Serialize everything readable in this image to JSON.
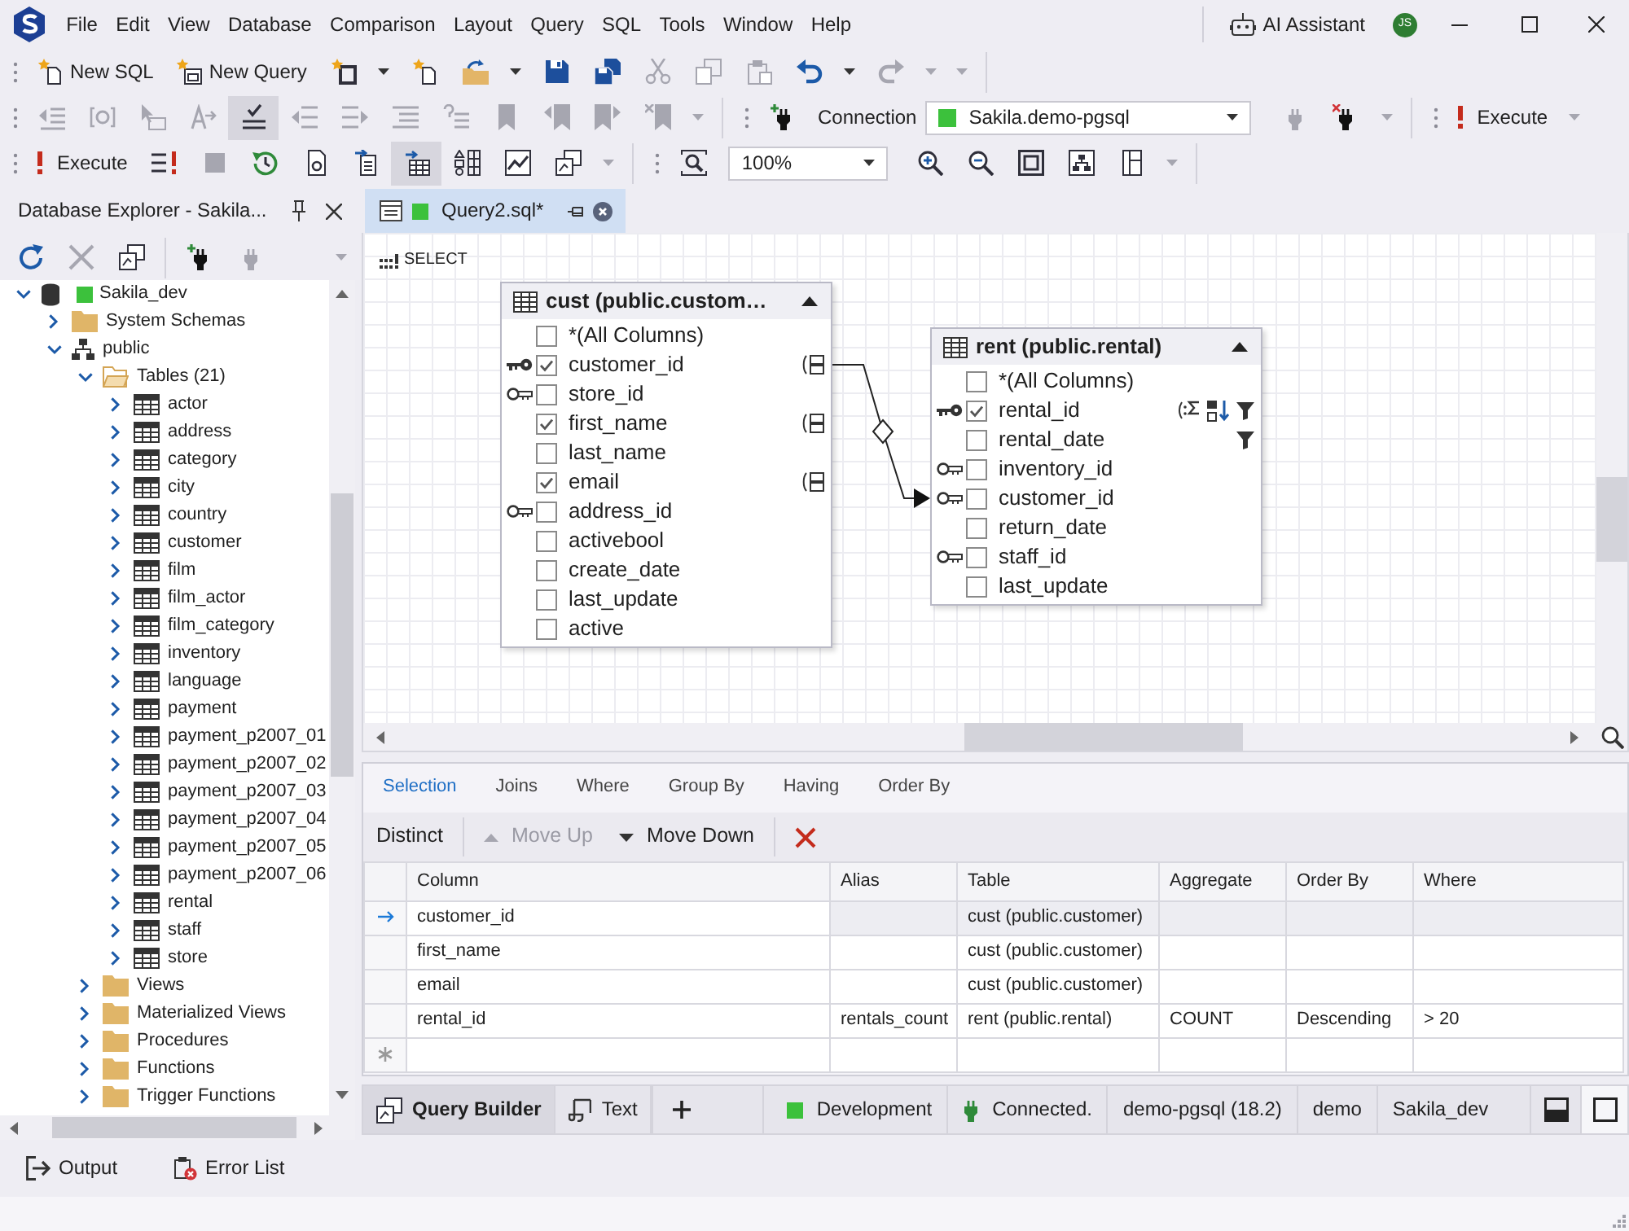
{
  "title_bar": {
    "menu": [
      "File",
      "Edit",
      "View",
      "Database",
      "Comparison",
      "Layout",
      "Query",
      "SQL",
      "Tools",
      "Window",
      "Help"
    ],
    "ai_assistant": "AI Assistant",
    "user_initials": "JS"
  },
  "toolbars": [
    {
      "items": [
        {
          "kind": "grip"
        },
        {
          "kind": "button",
          "label": "New SQL",
          "disabled": false,
          "pressed": false
        },
        {
          "kind": "button",
          "label": "New Query",
          "disabled": false,
          "pressed": false
        },
        {
          "kind": "button",
          "disabled": false,
          "pressed": false
        },
        {
          "kind": "caret",
          "disabled": false
        },
        {
          "kind": "button",
          "disabled": false,
          "pressed": false
        },
        {
          "kind": "button",
          "disabled": false,
          "pressed": false
        },
        {
          "kind": "caret",
          "disabled": false
        },
        {
          "kind": "button",
          "disabled": false,
          "pressed": false
        },
        {
          "kind": "button",
          "disabled": false,
          "pressed": false
        },
        {
          "kind": "button",
          "disabled": true,
          "pressed": false
        },
        {
          "kind": "button",
          "disabled": true,
          "pressed": false
        },
        {
          "kind": "button",
          "disabled": true,
          "pressed": false
        },
        {
          "kind": "button",
          "disabled": false,
          "pressed": false
        },
        {
          "kind": "caret",
          "disabled": false
        },
        {
          "kind": "button",
          "disabled": true,
          "pressed": false
        },
        {
          "kind": "caret",
          "disabled": true
        },
        {
          "kind": "caret",
          "disabled": true
        },
        {
          "kind": "separator"
        }
      ]
    },
    {
      "items": [
        {
          "kind": "grip"
        },
        {
          "kind": "button",
          "disabled": true,
          "pressed": false
        },
        {
          "kind": "button",
          "disabled": true,
          "pressed": false
        },
        {
          "kind": "button",
          "disabled": true,
          "pressed": false
        },
        {
          "kind": "button",
          "disabled": true,
          "pressed": false
        },
        {
          "kind": "button",
          "disabled": false,
          "pressed": true
        },
        {
          "kind": "button",
          "disabled": true,
          "pressed": false
        },
        {
          "kind": "button",
          "disabled": true,
          "pressed": false
        },
        {
          "kind": "button",
          "disabled": true,
          "pressed": false
        },
        {
          "kind": "button",
          "disabled": true,
          "pressed": false
        },
        {
          "kind": "button",
          "disabled": true,
          "pressed": false
        },
        {
          "kind": "button",
          "disabled": true,
          "pressed": false
        },
        {
          "kind": "button",
          "disabled": true,
          "pressed": false
        },
        {
          "kind": "button",
          "disabled": true,
          "pressed": false
        },
        {
          "kind": "caret",
          "disabled": true
        },
        {
          "kind": "separator"
        },
        {
          "kind": "grip"
        },
        {
          "kind": "button",
          "disabled": false,
          "pressed": false
        },
        {
          "kind": "label",
          "text": "Connection"
        },
        {
          "kind": "connection",
          "value": "Sakila.demo-pgsql"
        },
        {
          "kind": "button",
          "disabled": true,
          "pressed": false
        },
        {
          "kind": "button",
          "disabled": false,
          "pressed": false
        },
        {
          "kind": "caret",
          "disabled": true
        },
        {
          "kind": "separator"
        },
        {
          "kind": "grip"
        },
        {
          "kind": "button",
          "label": "Execute",
          "disabled": false,
          "pressed": false
        },
        {
          "kind": "caret",
          "disabled": true
        }
      ]
    },
    {
      "items": [
        {
          "kind": "grip"
        },
        {
          "kind": "button",
          "label": "Execute",
          "disabled": false,
          "pressed": false
        },
        {
          "kind": "button",
          "disabled": false,
          "pressed": false
        },
        {
          "kind": "button",
          "disabled": true,
          "pressed": false
        },
        {
          "kind": "button",
          "disabled": false,
          "pressed": false
        },
        {
          "kind": "button",
          "disabled": false,
          "pressed": false
        },
        {
          "kind": "button",
          "disabled": false,
          "pressed": false
        },
        {
          "kind": "button",
          "disabled": false,
          "pressed": true
        },
        {
          "kind": "button",
          "disabled": false,
          "pressed": false
        },
        {
          "kind": "button",
          "disabled": false,
          "pressed": false
        },
        {
          "kind": "button",
          "disabled": false,
          "pressed": false
        },
        {
          "kind": "caret",
          "disabled": true
        },
        {
          "kind": "separator"
        },
        {
          "kind": "grip"
        },
        {
          "kind": "button",
          "disabled": false,
          "pressed": false
        },
        {
          "kind": "combo",
          "value": "100%"
        },
        {
          "kind": "button",
          "disabled": false,
          "pressed": false
        },
        {
          "kind": "button",
          "disabled": false,
          "pressed": false
        },
        {
          "kind": "button",
          "disabled": false,
          "pressed": false
        },
        {
          "kind": "button",
          "disabled": false,
          "pressed": false
        },
        {
          "kind": "button",
          "disabled": false,
          "pressed": false
        },
        {
          "kind": "caret",
          "disabled": true
        },
        {
          "kind": "separator"
        }
      ]
    }
  ],
  "explorer": {
    "title": "Database Explorer - Sakila...",
    "toolbar": [
      {
        "kind": "button",
        "disabled": false,
        "pressed": false
      },
      {
        "kind": "button",
        "disabled": true,
        "pressed": false
      },
      {
        "kind": "button",
        "disabled": false,
        "pressed": false
      },
      {
        "kind": "separator"
      },
      {
        "kind": "button",
        "disabled": false,
        "pressed": false
      },
      {
        "kind": "button",
        "disabled": true,
        "pressed": false
      },
      {
        "kind": "caret",
        "disabled": true
      }
    ],
    "tree": [
      {
        "label": "Sakila_dev",
        "kind": "connection",
        "expanded": true,
        "children": [
          {
            "label": "System Schemas",
            "kind": "folder",
            "expanded": false
          },
          {
            "label": "public",
            "kind": "schema",
            "expanded": true,
            "children": [
              {
                "label": "Tables (21)",
                "kind": "folder",
                "expanded": true,
                "children": [
                  {
                    "label": "actor",
                    "kind": "table",
                    "expanded": false
                  },
                  {
                    "label": "address",
                    "kind": "table",
                    "expanded": false
                  },
                  {
                    "label": "category",
                    "kind": "table",
                    "expanded": false
                  },
                  {
                    "label": "city",
                    "kind": "table",
                    "expanded": false
                  },
                  {
                    "label": "country",
                    "kind": "table",
                    "expanded": false
                  },
                  {
                    "label": "customer",
                    "kind": "table",
                    "expanded": false
                  },
                  {
                    "label": "film",
                    "kind": "table",
                    "expanded": false
                  },
                  {
                    "label": "film_actor",
                    "kind": "table",
                    "expanded": false
                  },
                  {
                    "label": "film_category",
                    "kind": "table",
                    "expanded": false
                  },
                  {
                    "label": "inventory",
                    "kind": "table",
                    "expanded": false
                  },
                  {
                    "label": "language",
                    "kind": "table",
                    "expanded": false
                  },
                  {
                    "label": "payment",
                    "kind": "table",
                    "expanded": false
                  },
                  {
                    "label": "payment_p2007_01",
                    "kind": "table",
                    "expanded": false
                  },
                  {
                    "label": "payment_p2007_02",
                    "kind": "table",
                    "expanded": false
                  },
                  {
                    "label": "payment_p2007_03",
                    "kind": "table",
                    "expanded": false
                  },
                  {
                    "label": "payment_p2007_04",
                    "kind": "table",
                    "expanded": false
                  },
                  {
                    "label": "payment_p2007_05",
                    "kind": "table",
                    "expanded": false
                  },
                  {
                    "label": "payment_p2007_06",
                    "kind": "table",
                    "expanded": false
                  },
                  {
                    "label": "rental",
                    "kind": "table",
                    "expanded": false
                  },
                  {
                    "label": "staff",
                    "kind": "table",
                    "expanded": false
                  },
                  {
                    "label": "store",
                    "kind": "table",
                    "expanded": false
                  }
                ]
              },
              {
                "label": "Views",
                "kind": "folder",
                "expanded": false
              },
              {
                "label": "Materialized Views",
                "kind": "folder",
                "expanded": false
              },
              {
                "label": "Procedures",
                "kind": "folder",
                "expanded": false
              },
              {
                "label": "Functions",
                "kind": "folder",
                "expanded": false
              },
              {
                "label": "Trigger Functions",
                "kind": "folder",
                "expanded": false
              }
            ]
          }
        ]
      }
    ]
  },
  "document_tabs": [
    {
      "label": "Query2.sql*",
      "selected": true
    }
  ],
  "diagram": {
    "statement": "SELECT",
    "tables": [
      {
        "title": "cust (public.custom…",
        "expanded": true,
        "columns": [
          {
            "name": "*(All Columns)",
            "kind": "column",
            "checked": false
          },
          {
            "name": "customer_id",
            "kind": "primary_key",
            "checked": true,
            "indicators": [
              {
                "kind": "output"
              }
            ]
          },
          {
            "name": "store_id",
            "kind": "foreign_key",
            "checked": false
          },
          {
            "name": "first_name",
            "kind": "column",
            "checked": true,
            "indicators": [
              {
                "kind": "output"
              }
            ]
          },
          {
            "name": "last_name",
            "kind": "column",
            "checked": false
          },
          {
            "name": "email",
            "kind": "column",
            "checked": true,
            "indicators": [
              {
                "kind": "output"
              }
            ]
          },
          {
            "name": "address_id",
            "kind": "foreign_key",
            "checked": false
          },
          {
            "name": "activebool",
            "kind": "column",
            "checked": false
          },
          {
            "name": "create_date",
            "kind": "column",
            "checked": false
          },
          {
            "name": "last_update",
            "kind": "column",
            "checked": false
          },
          {
            "name": "active",
            "kind": "column",
            "checked": false
          }
        ]
      },
      {
        "title": "rent (public.rental)",
        "expanded": true,
        "columns": [
          {
            "name": "*(All Columns)",
            "kind": "column",
            "checked": false
          },
          {
            "name": "rental_id",
            "kind": "primary_key",
            "checked": true,
            "indicators": [
              {
                "kind": "aggregate"
              },
              {
                "kind": "sort_descending"
              },
              {
                "kind": "filter"
              }
            ]
          },
          {
            "name": "rental_date",
            "kind": "column",
            "checked": false,
            "indicators": [
              {
                "kind": "filter"
              }
            ]
          },
          {
            "name": "inventory_id",
            "kind": "foreign_key",
            "checked": false
          },
          {
            "name": "customer_id",
            "kind": "foreign_key",
            "checked": false
          },
          {
            "name": "return_date",
            "kind": "column",
            "checked": false
          },
          {
            "name": "staff_id",
            "kind": "foreign_key",
            "checked": false
          },
          {
            "name": "last_update",
            "kind": "column",
            "checked": false
          }
        ]
      }
    ]
  },
  "query_tabs": [
    {
      "label": "Selection",
      "selected": true
    },
    {
      "label": "Joins",
      "selected": false
    },
    {
      "label": "Where",
      "selected": false
    },
    {
      "label": "Group By",
      "selected": false
    },
    {
      "label": "Having",
      "selected": false
    },
    {
      "label": "Order By",
      "selected": false
    }
  ],
  "selection_toolbar": [
    {
      "kind": "toggle",
      "label": "Distinct",
      "pressed": false
    },
    {
      "kind": "separator"
    },
    {
      "kind": "move_up",
      "label": "Move Up",
      "disabled": true
    },
    {
      "kind": "move_down",
      "label": "Move Down",
      "disabled": false
    },
    {
      "kind": "separator"
    },
    {
      "kind": "delete",
      "disabled": false
    }
  ],
  "grid": {
    "columns": [
      "Column",
      "Alias",
      "Table",
      "Aggregate",
      "Order By",
      "Where"
    ],
    "rows": [
      {
        "selected": true,
        "column": "customer_id",
        "table": "cust (public.customer)"
      },
      {
        "selected": false,
        "column": "first_name",
        "table": "cust (public.customer)"
      },
      {
        "selected": false,
        "column": "email",
        "table": "cust (public.customer)"
      },
      {
        "selected": false,
        "column": "rental_id",
        "alias": "rentals_count",
        "table": "rent (public.rental)",
        "aggregate": "COUNT",
        "order_by": "Descending",
        "where": "> 20"
      }
    ]
  },
  "status_bar": {
    "views": [
      {
        "label": "Query Builder",
        "selected": true
      },
      {
        "label": "Text",
        "selected": false
      }
    ],
    "environment": "Development",
    "connection_state": "Connected.",
    "server": "demo-pgsql (18.2)",
    "user": "demo",
    "database": "Sakila_dev",
    "panel_toggles": [
      {
        "pressed": false
      },
      {
        "pressed": true
      }
    ]
  },
  "auto_hide_panels": [
    {
      "label": "Output"
    },
    {
      "label": "Error List"
    }
  ]
}
